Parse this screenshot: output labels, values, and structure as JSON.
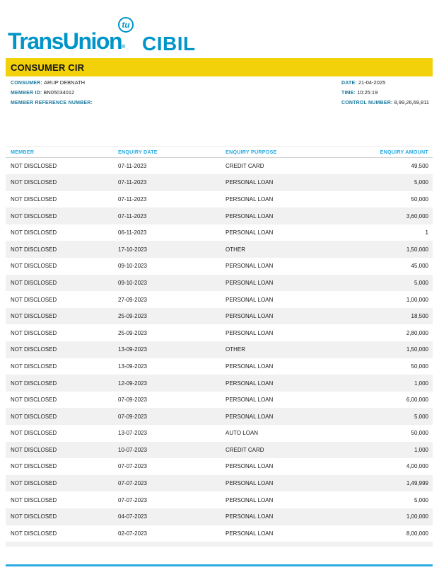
{
  "logo": {
    "brand": "TransUnion",
    "registered": "®",
    "monogram": "tu",
    "sub_brand": "CIBIL",
    "brand_color": "#0095c8"
  },
  "banner": {
    "title": "CONSUMER CIR",
    "bg_color": "#f2d10b"
  },
  "info": {
    "left": [
      {
        "label": "CONSUMER:",
        "value": "ARUP DEBNATH"
      },
      {
        "label": "MEMBER ID:",
        "value": "BN05034012"
      },
      {
        "label": "MEMBER REFERENCE NUMBER:",
        "value": ""
      }
    ],
    "right": [
      {
        "label": "DATE:",
        "value": "21-04-2025"
      },
      {
        "label": "TIME:",
        "value": "10:25:19"
      },
      {
        "label": "CONTROL NUMBER:",
        "value": "8,99,26,69,811"
      }
    ]
  },
  "table": {
    "columns": [
      "MEMBER",
      "ENQUIRY DATE",
      "ENQUIRY PURPOSE",
      "ENQUIRY AMOUNT"
    ],
    "header_color": "#29abe2",
    "alt_row_color": "#f1f1f1",
    "rows": [
      {
        "member": "NOT DISCLOSED",
        "date": "07-11-2023",
        "purpose": "CREDIT CARD",
        "amount": "49,500"
      },
      {
        "member": "NOT DISCLOSED",
        "date": "07-11-2023",
        "purpose": "PERSONAL LOAN",
        "amount": "5,000"
      },
      {
        "member": "NOT DISCLOSED",
        "date": "07-11-2023",
        "purpose": "PERSONAL LOAN",
        "amount": "50,000"
      },
      {
        "member": "NOT DISCLOSED",
        "date": "07-11-2023",
        "purpose": "PERSONAL LOAN",
        "amount": "3,60,000"
      },
      {
        "member": "NOT DISCLOSED",
        "date": "06-11-2023",
        "purpose": "PERSONAL LOAN",
        "amount": "1"
      },
      {
        "member": "NOT DISCLOSED",
        "date": "17-10-2023",
        "purpose": "OTHER",
        "amount": "1,50,000"
      },
      {
        "member": "NOT DISCLOSED",
        "date": "09-10-2023",
        "purpose": "PERSONAL LOAN",
        "amount": "45,000"
      },
      {
        "member": "NOT DISCLOSED",
        "date": "09-10-2023",
        "purpose": "PERSONAL LOAN",
        "amount": "5,000"
      },
      {
        "member": "NOT DISCLOSED",
        "date": "27-09-2023",
        "purpose": "PERSONAL LOAN",
        "amount": "1,00,000"
      },
      {
        "member": "NOT DISCLOSED",
        "date": "25-09-2023",
        "purpose": "PERSONAL LOAN",
        "amount": "18,500"
      },
      {
        "member": "NOT DISCLOSED",
        "date": "25-09-2023",
        "purpose": "PERSONAL LOAN",
        "amount": "2,80,000"
      },
      {
        "member": "NOT DISCLOSED",
        "date": "13-09-2023",
        "purpose": "OTHER",
        "amount": "1,50,000"
      },
      {
        "member": "NOT DISCLOSED",
        "date": "13-09-2023",
        "purpose": "PERSONAL LOAN",
        "amount": "50,000"
      },
      {
        "member": "NOT DISCLOSED",
        "date": "12-09-2023",
        "purpose": "PERSONAL LOAN",
        "amount": "1,000"
      },
      {
        "member": "NOT DISCLOSED",
        "date": "07-09-2023",
        "purpose": "PERSONAL LOAN",
        "amount": "6,00,000"
      },
      {
        "member": "NOT DISCLOSED",
        "date": "07-09-2023",
        "purpose": "PERSONAL LOAN",
        "amount": "5,000"
      },
      {
        "member": "NOT DISCLOSED",
        "date": "13-07-2023",
        "purpose": "AUTO LOAN",
        "amount": "50,000"
      },
      {
        "member": "NOT DISCLOSED",
        "date": "10-07-2023",
        "purpose": "CREDIT CARD",
        "amount": "1,000"
      },
      {
        "member": "NOT DISCLOSED",
        "date": "07-07-2023",
        "purpose": "PERSONAL LOAN",
        "amount": "4,00,000"
      },
      {
        "member": "NOT DISCLOSED",
        "date": "07-07-2023",
        "purpose": "PERSONAL LOAN",
        "amount": "1,49,999"
      },
      {
        "member": "NOT DISCLOSED",
        "date": "07-07-2023",
        "purpose": "PERSONAL LOAN",
        "amount": "5,000"
      },
      {
        "member": "NOT DISCLOSED",
        "date": "04-07-2023",
        "purpose": "PERSONAL LOAN",
        "amount": "1,00,000"
      },
      {
        "member": "NOT DISCLOSED",
        "date": "02-07-2023",
        "purpose": "PERSONAL LOAN",
        "amount": "8,00,000"
      }
    ]
  }
}
